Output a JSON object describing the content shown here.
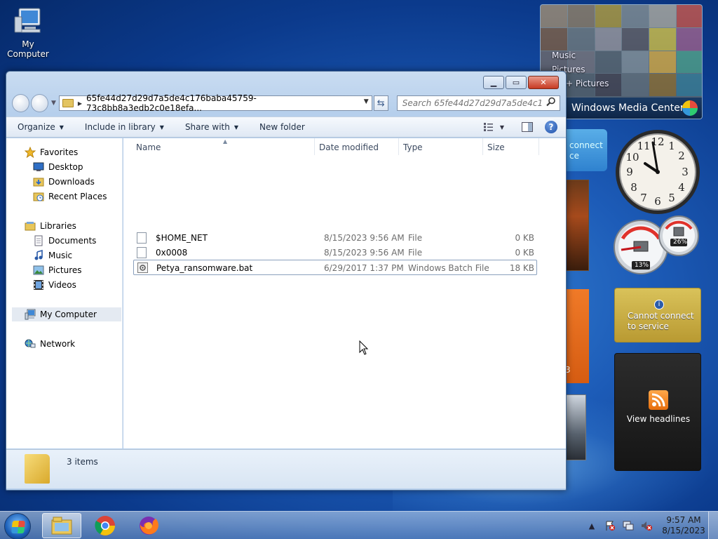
{
  "desktop": {
    "icons": [
      {
        "label": "My Computer"
      }
    ]
  },
  "window": {
    "address": "65fe44d27d29d7a5de4c176baba45759-73c8bb8a3edb2c0e18efa...",
    "search_placeholder": "Search 65fe44d27d29d7a5de4c176bab...",
    "toolbar": {
      "organize": "Organize",
      "include_in_library": "Include in library",
      "share_with": "Share with",
      "new_folder": "New folder"
    },
    "nav": {
      "favorites": "Favorites",
      "desktop": "Desktop",
      "downloads": "Downloads",
      "recent_places": "Recent Places",
      "libraries": "Libraries",
      "documents": "Documents",
      "music": "Music",
      "pictures": "Pictures",
      "videos": "Videos",
      "my_computer": "My Computer",
      "network": "Network"
    },
    "columns": {
      "name": "Name",
      "date_modified": "Date modified",
      "type": "Type",
      "size": "Size"
    },
    "files": [
      {
        "name": "$HOME_NET",
        "date": "8/15/2023 9:56 AM",
        "type": "File",
        "size": "0 KB"
      },
      {
        "name": "0x0008",
        "date": "8/15/2023 9:56 AM",
        "type": "File",
        "size": "0 KB"
      },
      {
        "name": "Petya_ransomware.bat",
        "date": "6/29/2017 1:37 PM",
        "type": "Windows Batch File",
        "size": "18 KB"
      }
    ],
    "status": "3 items"
  },
  "gadgets": {
    "media_center": {
      "menu": [
        "Music",
        "Pictures",
        "sic + Pictures"
      ],
      "title": "Windows Media Center"
    },
    "cpu": {
      "cpu_percent": "13%",
      "memory_percent": "26%"
    },
    "weather": {
      "line1": "Cannot connect",
      "line2": "to service"
    },
    "feed": {
      "label": "View headlines"
    },
    "partial_blue": {
      "line1": "connect",
      "line2": "ce"
    },
    "partial_calendar": {
      "digit": "3"
    }
  },
  "taskbar": {
    "time": "9:57 AM",
    "date": "8/15/2023"
  }
}
